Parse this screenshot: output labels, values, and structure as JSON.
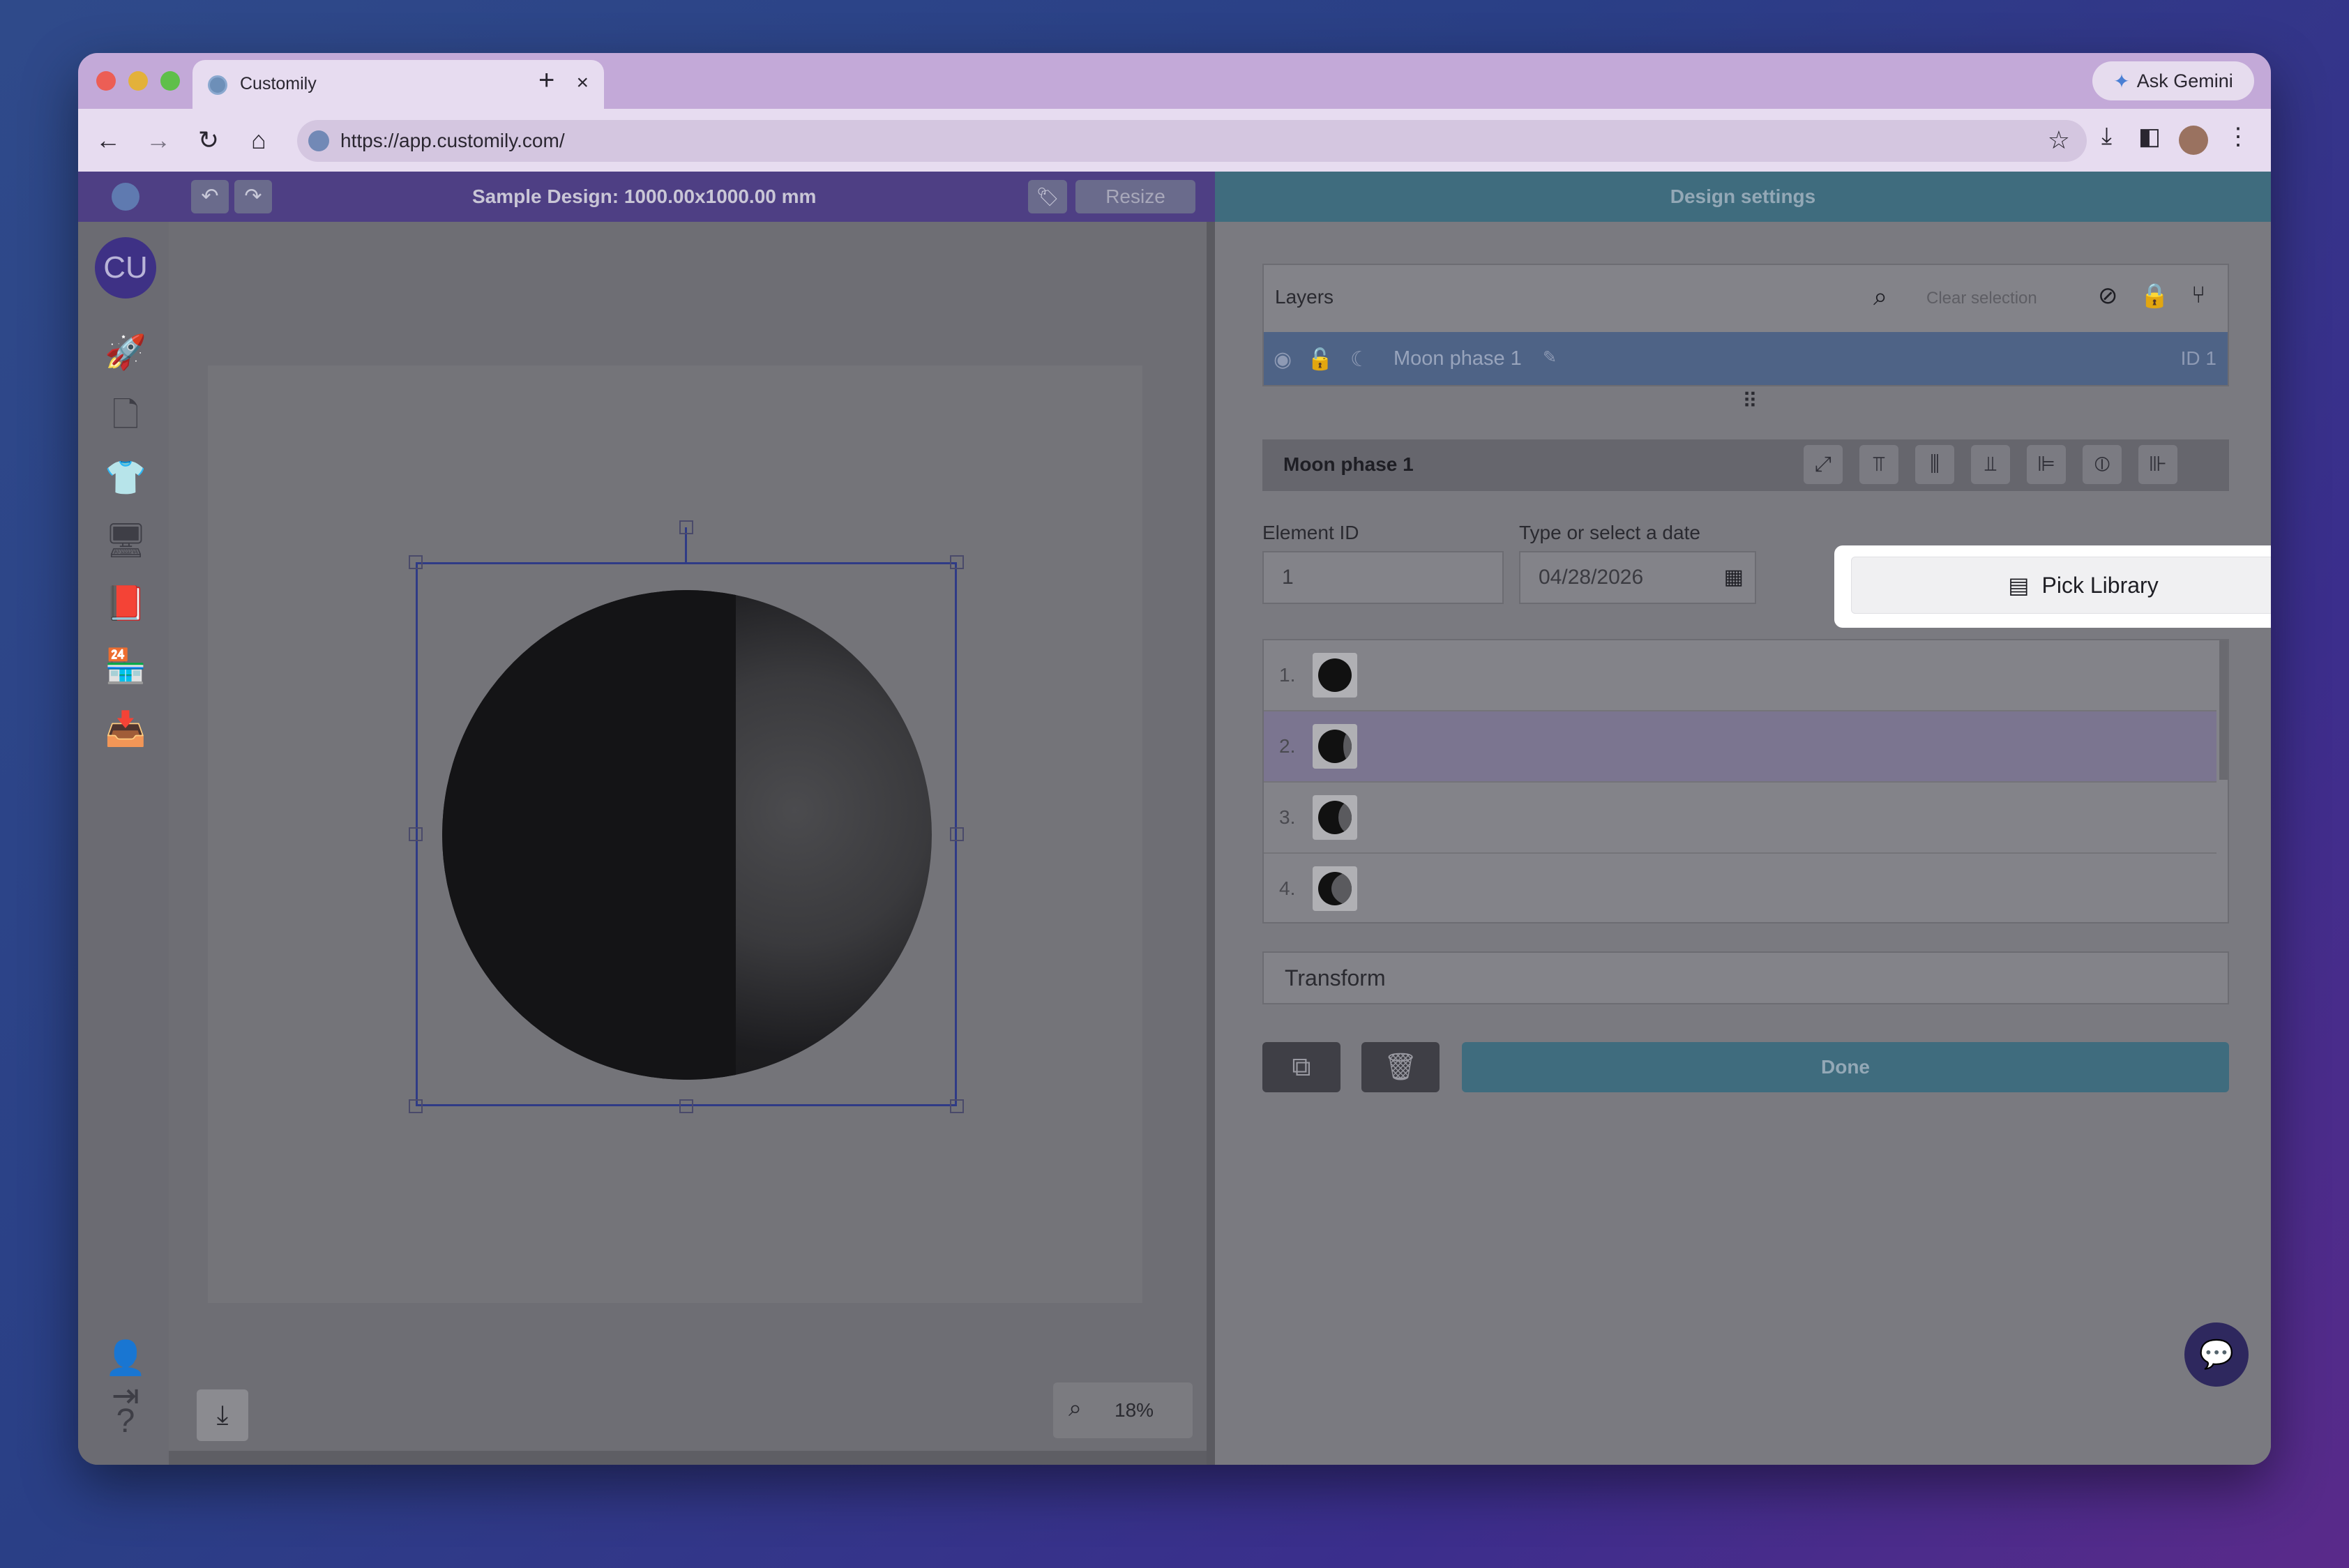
{
  "browser": {
    "tab_title": "Customily",
    "tab_close": "×",
    "new_tab": "+",
    "ask_gemini": "Ask Gemini",
    "url": "https://app.customily.com/"
  },
  "app": {
    "design_title": "Sample Design: 1000.00x1000.00 mm",
    "resize_label": "Resize",
    "settings_title": "Design settings",
    "avatar_initials": "CU",
    "zoom_level": "18%"
  },
  "layers": {
    "title": "Layers",
    "clear_selection": "Clear selection",
    "rows": [
      {
        "name": "Moon phase 1",
        "id_label": "ID 1"
      }
    ]
  },
  "element": {
    "title": "Moon phase 1",
    "element_id_label": "Element ID",
    "element_id_value": "1",
    "date_label": "Type or select a date",
    "date_value": "04/28/2026",
    "pick_library_label": "Pick Library",
    "phases": [
      {
        "num": "1.",
        "lit": 0.0
      },
      {
        "num": "2.",
        "lit": 0.25
      },
      {
        "num": "3.",
        "lit": 0.4
      },
      {
        "num": "4.",
        "lit": 0.6
      }
    ],
    "selected_phase_index": 1,
    "transform_label": "Transform",
    "done_label": "Done"
  },
  "colors": {
    "selected_phase_row": "#7b7590",
    "accent_teal": "#3f6c7e",
    "brand_purple": "#4e3f84"
  }
}
